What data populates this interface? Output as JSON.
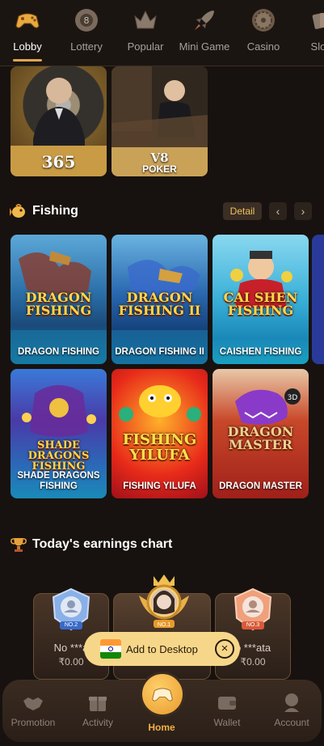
{
  "top_tabs": [
    {
      "label": "Lobby",
      "icon": "gamepad-icon",
      "active": true
    },
    {
      "label": "Lottery",
      "icon": "lottery-ball-icon",
      "active": false
    },
    {
      "label": "Popular",
      "icon": "crown-icon",
      "active": false
    },
    {
      "label": "Mini Game",
      "icon": "rocket-icon",
      "active": false
    },
    {
      "label": "Casino",
      "icon": "roulette-icon",
      "active": false
    },
    {
      "label": "Slots",
      "icon": "slot-cards-icon",
      "active": false
    }
  ],
  "live_cards": [
    {
      "label": "365"
    },
    {
      "label_top": "V8",
      "label_bottom": "POKER"
    }
  ],
  "fishing": {
    "title": "Fishing",
    "detail_label": "Detail",
    "games": [
      {
        "logo": "DRAGON FISHING",
        "name": "DRAGON FISHING"
      },
      {
        "logo": "DRAGON FISHING II",
        "name": "DRAGON FISHING II"
      },
      {
        "logo": "CAI SHEN FISHING",
        "name": "CAISHEN FISHING"
      },
      {
        "logo": "SHADE DRAGONS FISHING",
        "name": "SHADE DRAGONS FISHING"
      },
      {
        "logo": "FISHING YILUFA",
        "name": "FISHING YILUFA"
      },
      {
        "logo": "DRAGON MASTER",
        "name": "DRAGON MASTER"
      }
    ]
  },
  "earnings": {
    "title": "Today's earnings chart",
    "ranks": [
      {
        "badge": "NO.2",
        "name": "No ***a",
        "amount": "₹0.00"
      },
      {
        "badge": "NO.1",
        "name": "",
        "amount": ""
      },
      {
        "badge": "NO.3",
        "name": "o ***ata",
        "amount": "₹0.00"
      }
    ]
  },
  "add_to_desktop": {
    "label": "Add to Desktop"
  },
  "bottom_nav": [
    {
      "label": "Promotion",
      "icon": "handshake-icon"
    },
    {
      "label": "Activity",
      "icon": "gift-icon"
    },
    {
      "label": "Home",
      "icon": "gamepad-icon"
    },
    {
      "label": "Wallet",
      "icon": "wallet-icon"
    },
    {
      "label": "Account",
      "icon": "user-icon"
    }
  ],
  "colors": {
    "accent": "#e0a64a",
    "background": "#17120f",
    "home": "#f3b142"
  }
}
